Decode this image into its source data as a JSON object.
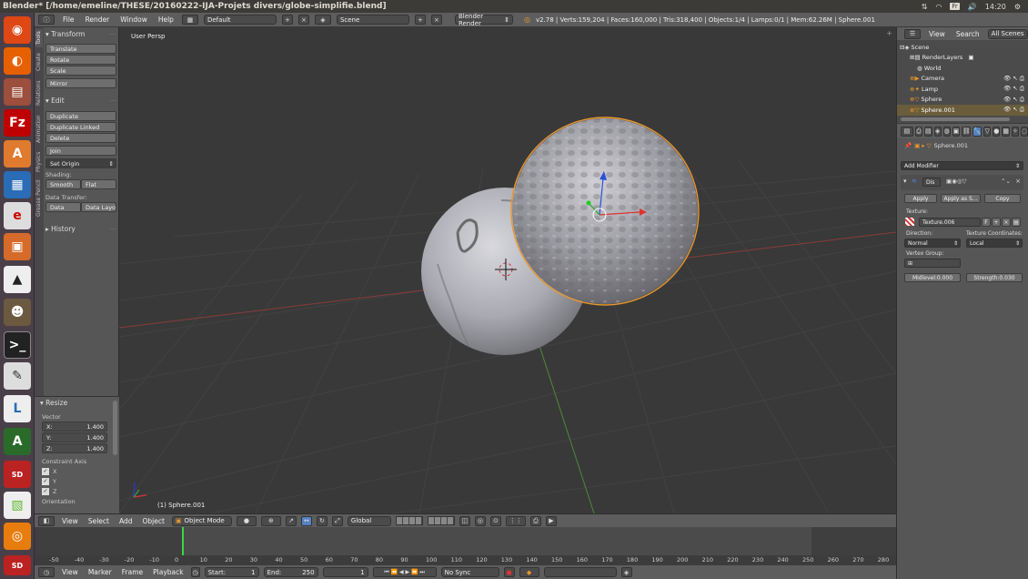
{
  "window_title": "Blender* [/home/emeline/THESE/20160222-IJA-Projets divers/globe-simplifie.blend]",
  "system_tray": {
    "lang": "Fr",
    "time": "14:20"
  },
  "colors": {
    "selected_orange": "#e8962d",
    "accent_blue": "#5680c2",
    "viewport_bg": "#393939"
  },
  "info_header": {
    "menus": [
      "File",
      "Render",
      "Window",
      "Help"
    ],
    "layout": "Default",
    "scene": "Scene",
    "engine": "Blender Render",
    "stats": "v2.78 | Verts:159,204 | Faces:160,000 | Tris:318,400 | Objects:1/4 | Lamps:0/1 | Mem:62.26M | Sphere.001"
  },
  "tool_tabs": [
    "Tools",
    "Create",
    "Relations",
    "Animation",
    "Physics",
    "Grease Pencil"
  ],
  "tools": {
    "transform_header": "Transform",
    "translate": "Translate",
    "rotate": "Rotate",
    "scale": "Scale",
    "mirror": "Mirror",
    "edit_header": "Edit",
    "duplicate": "Duplicate",
    "duplicate_linked": "Duplicate Linked",
    "delete": "Delete",
    "join": "Join",
    "set_origin": "Set Origin",
    "shading_label": "Shading:",
    "smooth": "Smooth",
    "flat": "Flat",
    "data_transfer_label": "Data Transfer:",
    "data": "Data",
    "data_layo": "Data Layo",
    "history_header": "History"
  },
  "operator": {
    "title": "Resize",
    "vector_label": "Vector",
    "x": "1.400",
    "y": "1.400",
    "z": "1.400",
    "constraint_label": "Constraint Axis",
    "axes": [
      "X",
      "Y",
      "Z"
    ],
    "orientation_label": "Orientation"
  },
  "viewport": {
    "view_name": "User Persp",
    "object_label": "(1) Sphere.001"
  },
  "viewport_header": {
    "menus": [
      "View",
      "Select",
      "Add",
      "Object"
    ],
    "mode": "Object Mode",
    "orientation": "Global"
  },
  "timeline": {
    "ticks": [
      "-50",
      "-40",
      "-30",
      "-20",
      "-10",
      "0",
      "10",
      "20",
      "30",
      "40",
      "50",
      "60",
      "70",
      "80",
      "90",
      "100",
      "110",
      "120",
      "130",
      "140",
      "150",
      "160",
      "170",
      "180",
      "190",
      "200",
      "210",
      "220",
      "230",
      "240",
      "250",
      "260",
      "270",
      "280"
    ],
    "menus": [
      "View",
      "Marker",
      "Frame",
      "Playback"
    ],
    "start": "Start:",
    "start_value": "1",
    "end": "End:",
    "end_value": "250",
    "current": "1",
    "sync": "No Sync"
  },
  "outliner": {
    "menus": [
      "View",
      "Search",
      "All Scenes"
    ],
    "items": [
      "Scene",
      "RenderLayers",
      "World",
      "Camera",
      "Lamp",
      "Sphere",
      "Sphere.001"
    ]
  },
  "properties": {
    "breadcrumb": "Sphere.001",
    "add_modifier": "Add Modifier",
    "modifier_name": "Dis",
    "apply": "Apply",
    "apply_as": "Apply as S...",
    "copy": "Copy",
    "texture_label": "Texture:",
    "texture": "Texture.006",
    "texture_flag": "F",
    "direction_label": "Direction:",
    "direction": "Normal",
    "coords_label": "Texture Coordinates:",
    "coords": "Local",
    "vgroup_label": "Vertex Group:",
    "midlevel": "Midlevel:0.000",
    "strength": "Strength:0.030"
  }
}
